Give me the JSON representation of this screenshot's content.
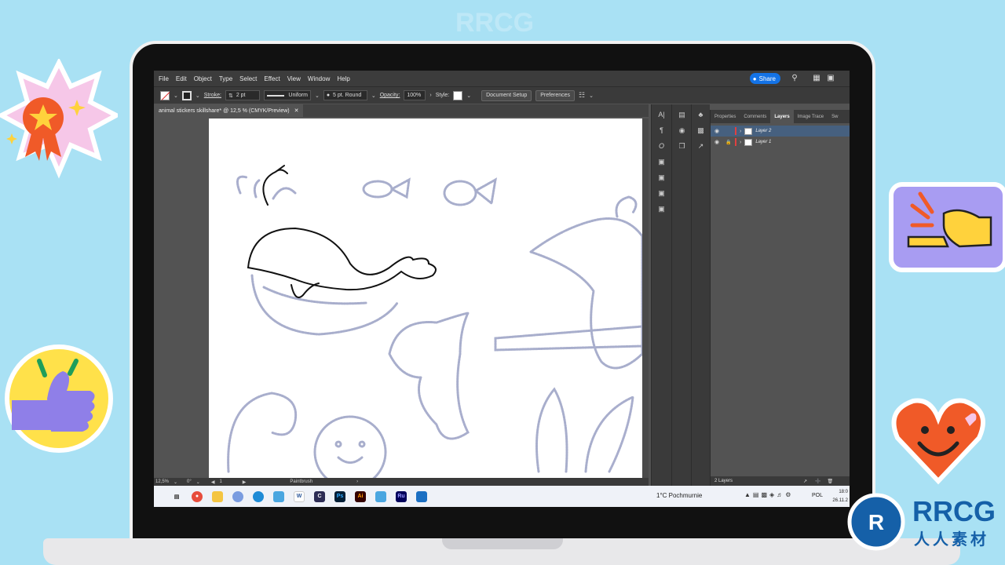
{
  "menu": [
    "File",
    "Edit",
    "Object",
    "Type",
    "Select",
    "Effect",
    "View",
    "Window",
    "Help"
  ],
  "share_label": "Share",
  "control_bar": {
    "stroke_label": "Stroke:",
    "stroke_weight": "2 pt",
    "profile": "Uniform",
    "brush": "5 pt. Round",
    "opacity_label": "Opacity:",
    "opacity_value": "100%",
    "style_label": "Style:",
    "doc_setup": "Document Setup",
    "preferences": "Preferences"
  },
  "document_tab": "animal stickers skillshare* @ 12,5 % (CMYK/Preview)",
  "status_bar": {
    "zoom": "12,5%",
    "rotation": "0°",
    "artboard": "1",
    "tool": "Paintbrush"
  },
  "layers_panel": {
    "tabs": [
      "Properties",
      "Comments",
      "Layers",
      "Image Trace",
      "Sw"
    ],
    "active_tab": "Layers",
    "layers": [
      {
        "name": "Layer 2",
        "color": "#e04040"
      },
      {
        "name": "Layer 1",
        "color": "#e04040"
      }
    ],
    "count": "2 Layers"
  },
  "taskbar": {
    "weather": "1°C  Pochmurnie",
    "language": "POL",
    "time": "18:0",
    "date": "26.11.2"
  },
  "logo": {
    "main": "RRCG",
    "sub": "人人素材"
  },
  "watermark_text": "RRCG"
}
